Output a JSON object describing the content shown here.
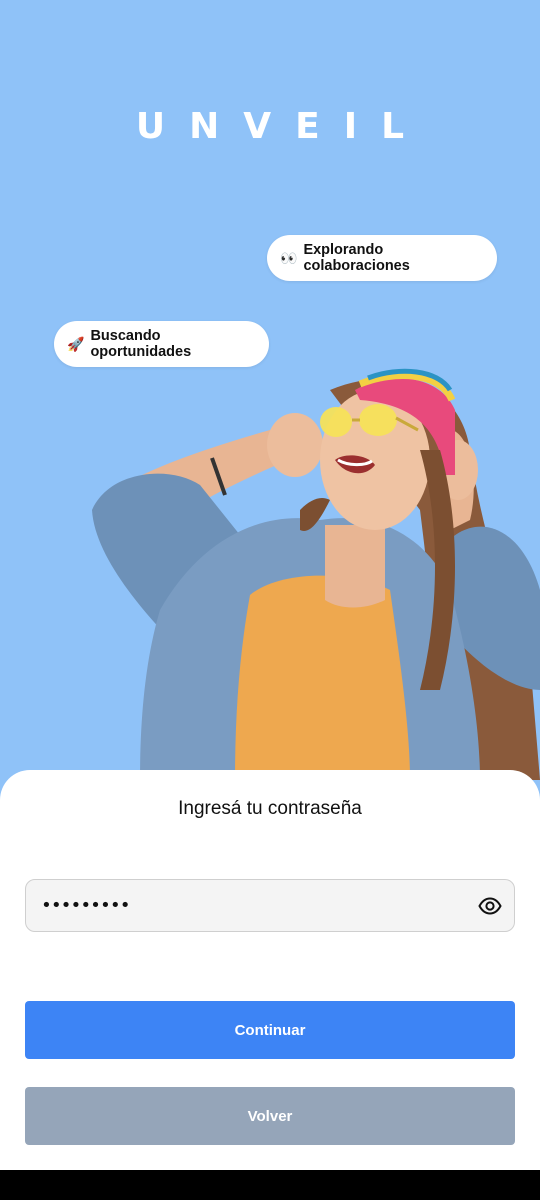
{
  "app": {
    "brand": "UNVEIL"
  },
  "chips": [
    {
      "emoji": "👀",
      "label": "Explorando colaboraciones"
    },
    {
      "emoji": "🚀",
      "label": "Buscando oportunidades"
    }
  ],
  "hero": {
    "icon": "person-photo"
  },
  "login": {
    "title": "Ingresá tu contraseña",
    "password_value": "•••••••••",
    "toggle_icon": "eye-icon"
  },
  "buttons": {
    "continue_label": "Continuar",
    "back_label": "Volver"
  },
  "colors": {
    "background": "#8fc2f8",
    "primary": "#3d84f5",
    "secondary": "#95a5b9"
  }
}
